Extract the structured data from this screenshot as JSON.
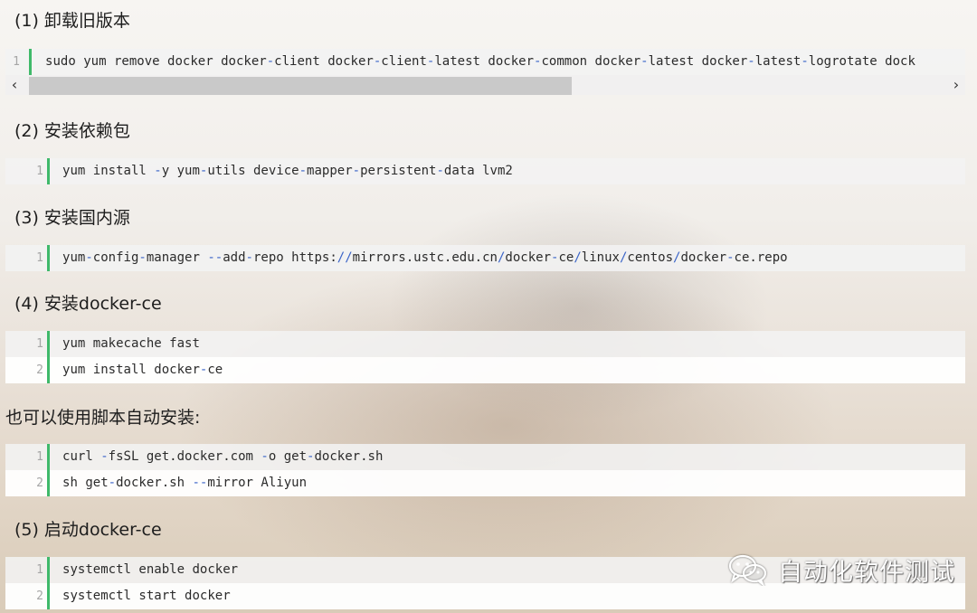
{
  "sections": {
    "s1": {
      "num": "(1)",
      "title": "卸载旧版本"
    },
    "s2": {
      "num": "(2)",
      "title": "安装依赖包"
    },
    "s3": {
      "num": "(3)",
      "title": "安装国内源"
    },
    "s4": {
      "num": "(4)",
      "title": "安装docker-ce"
    },
    "note": "也可以使用脚本自动安装:",
    "s5": {
      "num": "(5)",
      "title": "启动docker-ce"
    }
  },
  "blocks": {
    "b1": {
      "lines": [
        {
          "n": "1",
          "code": "sudo yum remove docker docker-client docker-client-latest docker-common docker-latest docker-latest-logrotate dock"
        }
      ]
    },
    "b2": {
      "lines": [
        {
          "n": "1",
          "code": "yum install -y yum-utils device-mapper-persistent-data lvm2"
        }
      ]
    },
    "b3": {
      "lines": [
        {
          "n": "1",
          "code": "yum-config-manager --add-repo https://mirrors.ustc.edu.cn/docker-ce/linux/centos/docker-ce.repo"
        }
      ]
    },
    "b4": {
      "lines": [
        {
          "n": "1",
          "code": "yum makecache fast"
        },
        {
          "n": "2",
          "code": "yum install docker-ce"
        }
      ]
    },
    "b5": {
      "lines": [
        {
          "n": "1",
          "code": "curl -fsSL get.docker.com -o get-docker.sh"
        },
        {
          "n": "2",
          "code": "sh get-docker.sh --mirror Aliyun"
        }
      ]
    },
    "b6": {
      "lines": [
        {
          "n": "1",
          "code": "systemctl enable docker"
        },
        {
          "n": "2",
          "code": "systemctl start docker"
        }
      ]
    }
  },
  "scrollbar": {
    "left_arrow": "‹",
    "right_arrow": "›"
  },
  "watermark": {
    "text": "自动化软件测试",
    "icon": "wechat-icon"
  },
  "colors": {
    "gutter": "#3fb96a",
    "separator": "#3a64c8"
  }
}
